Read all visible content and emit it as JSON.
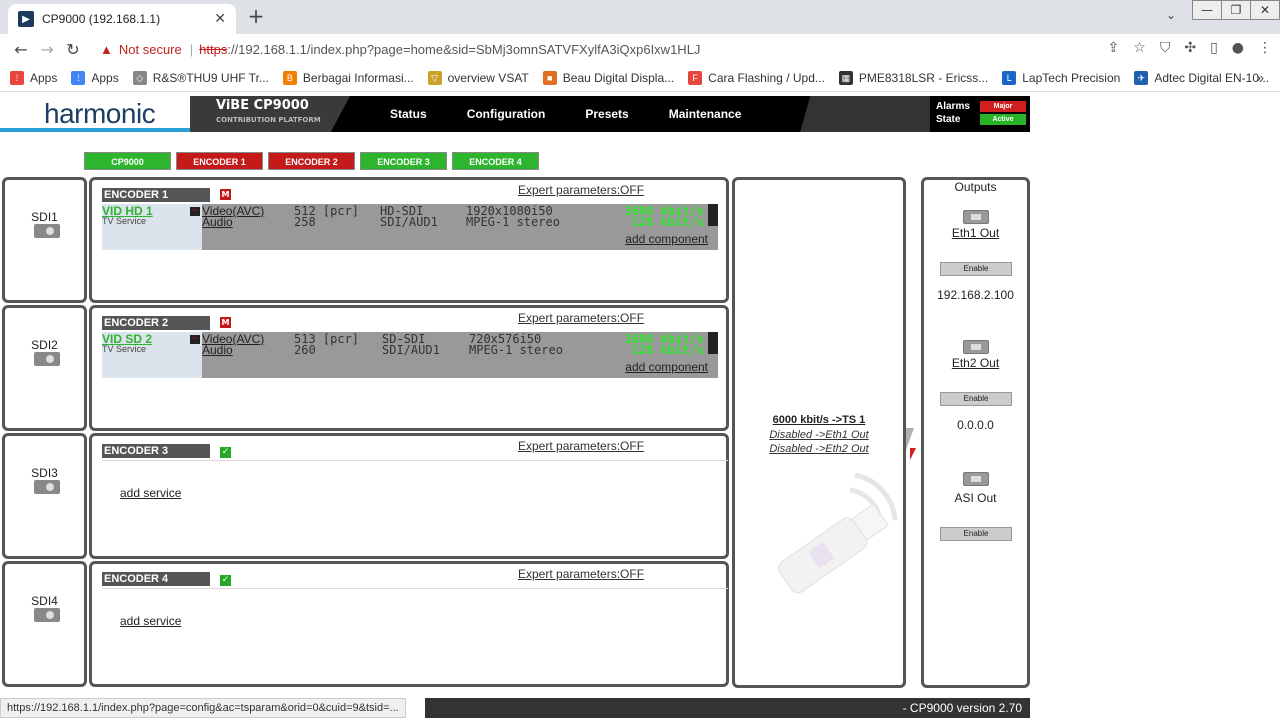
{
  "browser": {
    "tab_title": "CP9000 (192.168.1.1)",
    "not_secure": "Not secure",
    "url_https": "https",
    "url_rest": "://192.168.1.1/index.php?page=home&sid=SbMj3omnSATVFXylfA3iQxp6Ixw1HLJ",
    "bookmarks": [
      "Apps",
      "Apps",
      "R&S®THU9 UHF Tr...",
      "Berbagai Informasi...",
      "overview VSAT",
      "Beau Digital Displa...",
      "Cara Flashing / Upd...",
      "PME8318LSR - Ericss...",
      "LapTech Precision",
      "Adtec Digital EN-10..."
    ],
    "status_url": "https://192.168.1.1/index.php?page=config&ac=tsparam&orid=0&cuid=9&tsid=..."
  },
  "header": {
    "logo": "harmonic",
    "product": "ViBE CP9000",
    "product_sub": "CONTRIBUTION PLATFORM",
    "nav": [
      "Status",
      "Configuration",
      "Presets",
      "Maintenance"
    ],
    "alarms_label": "Alarms",
    "alarms_value": "Major",
    "state_label": "State",
    "state_value": "Active"
  },
  "tabs": [
    "CP9000",
    "ENCODER 1",
    "ENCODER 2",
    "ENCODER 3",
    "ENCODER 4"
  ],
  "inputs": [
    "SDI1",
    "SDI2",
    "SDI3",
    "SDI4"
  ],
  "expert": "Expert parameters:OFF",
  "encoders": [
    {
      "title": "ENCODER 1",
      "badge": "M",
      "service": "VID HD 1",
      "service_type": "TV Service",
      "components": [
        {
          "name": "Video(AVC)",
          "pid": "512 [pcr]",
          "src": "HD-SDI",
          "fmt": "1920x1080i50",
          "rate": "3600 kbit/s"
        },
        {
          "name": "Audio",
          "pid": "258",
          "src": "SDI/AUD1",
          "fmt": "MPEG-1 stereo",
          "rate": "128 kbit/s"
        }
      ],
      "add_component": "add component"
    },
    {
      "title": "ENCODER 2",
      "badge": "M",
      "service": "VID SD 2",
      "service_type": "TV Service",
      "components": [
        {
          "name": "Video(AVC)",
          "pid": "513 [pcr]",
          "src": "SD-SDI",
          "fmt": "720x576i50",
          "rate": "1600 kbit/s"
        },
        {
          "name": "Audio",
          "pid": "260",
          "src": "SDI/AUD1",
          "fmt": "MPEG-1 stereo",
          "rate": "128 kbit/s"
        }
      ],
      "add_component": "add component"
    },
    {
      "title": "ENCODER 3",
      "badge": "✓",
      "add_service": "add service"
    },
    {
      "title": "ENCODER 4",
      "badge": "✓",
      "add_service": "add service"
    }
  ],
  "mux": {
    "main": "6000 kbit/s ->TS 1",
    "eth1": "Disabled ->Eth1 Out",
    "eth2": "Disabled ->Eth2 Out"
  },
  "outputs": {
    "title": "Outputs",
    "items": [
      {
        "name": "Eth1 Out",
        "enable": "Enable",
        "ip": "192.168.2.100"
      },
      {
        "name": "Eth2 Out",
        "enable": "Enable",
        "ip": "0.0.0.0"
      },
      {
        "name": "ASI Out",
        "enable": "Enable"
      }
    ]
  },
  "version": "- CP9000 version 2.70",
  "colors": {
    "accent_green": "#2db52d",
    "accent_red": "#c41a1a",
    "header_bg": "#000000"
  }
}
